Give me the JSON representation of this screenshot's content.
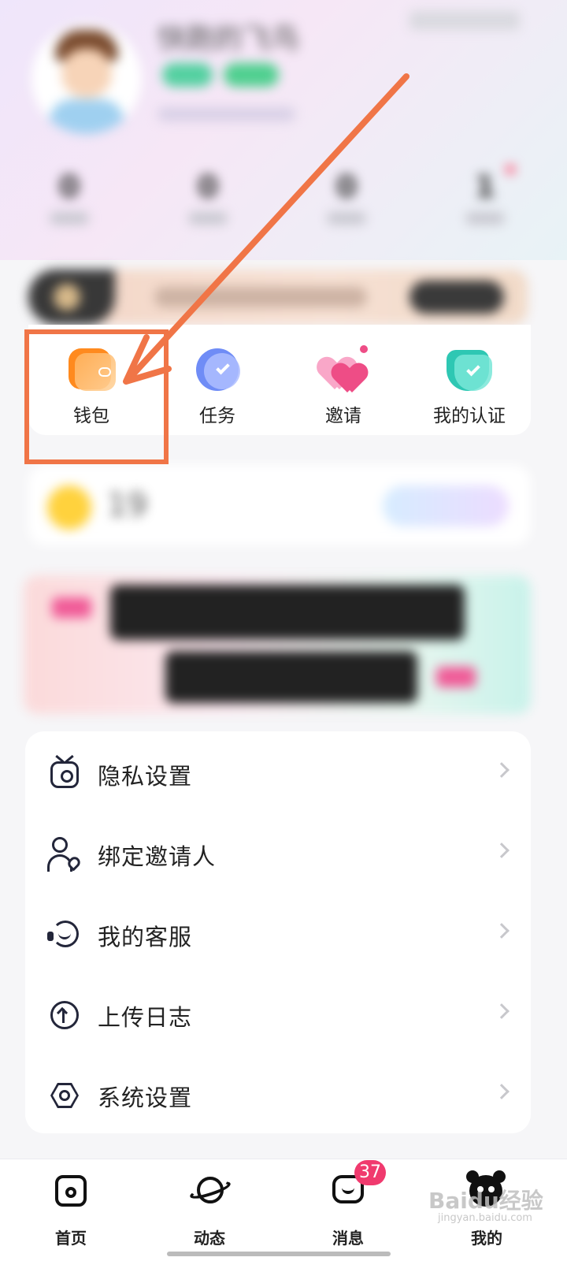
{
  "profile": {
    "nickname": "快跑的飞鸟",
    "stats": [
      "0",
      "0",
      "0",
      "1"
    ]
  },
  "quick_actions": [
    {
      "label": "钱包",
      "icon": "wallet-icon"
    },
    {
      "label": "任务",
      "icon": "task-check-icon"
    },
    {
      "label": "邀请",
      "icon": "hearts-icon"
    },
    {
      "label": "我的认证",
      "icon": "verified-shield-icon"
    }
  ],
  "coins": {
    "value": "19"
  },
  "menu": [
    {
      "label": "隐私设置",
      "icon": "privacy-icon"
    },
    {
      "label": "绑定邀请人",
      "icon": "invite-user-icon"
    },
    {
      "label": "我的客服",
      "icon": "customer-service-icon"
    },
    {
      "label": "上传日志",
      "icon": "upload-icon"
    },
    {
      "label": "系统设置",
      "icon": "settings-icon"
    }
  ],
  "bottom_nav": {
    "tabs": [
      {
        "label": "首页",
        "icon": "home-icon"
      },
      {
        "label": "动态",
        "icon": "planet-icon"
      },
      {
        "label": "消息",
        "icon": "chat-icon"
      },
      {
        "label": "我的",
        "icon": "bear-avatar-icon"
      }
    ],
    "message_badge": "37",
    "active_tab": "我的"
  },
  "watermark": {
    "text": "Baidu经验",
    "sub": "jingyan.baidu.com"
  },
  "colors": {
    "annotation": "#f07547",
    "badge": "#f03a6e",
    "wallet": "#ff8a1e",
    "task": "#6f8cf6",
    "invite": "#ee4d86",
    "verify": "#2ec7b3"
  }
}
